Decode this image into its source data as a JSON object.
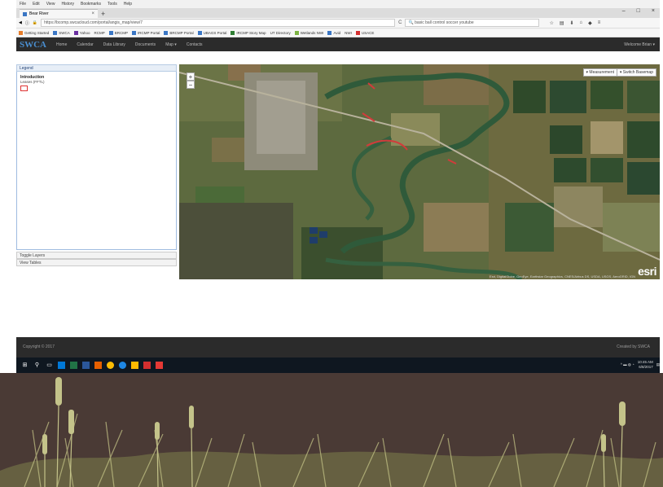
{
  "browser": {
    "menu": [
      "File",
      "Edit",
      "View",
      "History",
      "Bookmarks",
      "Tools",
      "Help"
    ],
    "tab_title": "Bear River",
    "url": "https://bcomp.swcacloud.com/portal/angis_map/view/7",
    "search_text": "basic ball control soccer youtube",
    "bookmarks": [
      "Getting Started",
      "SWCA",
      "Yahoo",
      "RCMP",
      "BRCMP",
      "IRCMP Portal",
      "BRCMP Portal",
      "UBAGS Portal",
      "IRCMP Story Map",
      "UT Directory",
      "Wetlands NWI",
      "Avid",
      "NWI",
      "USACE"
    ]
  },
  "app": {
    "logo": "SWCA",
    "nav": [
      "Home",
      "Calendar",
      "Data Library",
      "Documents",
      "Map ▾",
      "Contacts"
    ],
    "welcome": "Welcome Brian ▾"
  },
  "legend": {
    "header": "Legend",
    "group": "Introduction",
    "layer": "Leases (FFTL)",
    "toggle_layers": "Toggle Layers",
    "view_tables": "View Tables"
  },
  "map": {
    "zoom_in": "+",
    "zoom_out": "−",
    "measurement_btn": "▾ Measurement",
    "basemap_btn": "▾ Switch Basemap",
    "attribution": "Esri, DigitalGlobe, GeoEye, Earthstar Geographics, CNES/Airbus DS, USDA, USGS, AeroGRID, IGN",
    "esri_logo": "esri"
  },
  "footer": {
    "copyright": "Copyright © 2017",
    "created_by": "Created by SWCA"
  },
  "taskbar": {
    "time": "10:45 AM",
    "date": "6/8/2017"
  },
  "colors": {
    "nav_bg": "#2b2b2b",
    "accent": "#4a8fd1",
    "slide_bg": "#4a3a35"
  }
}
